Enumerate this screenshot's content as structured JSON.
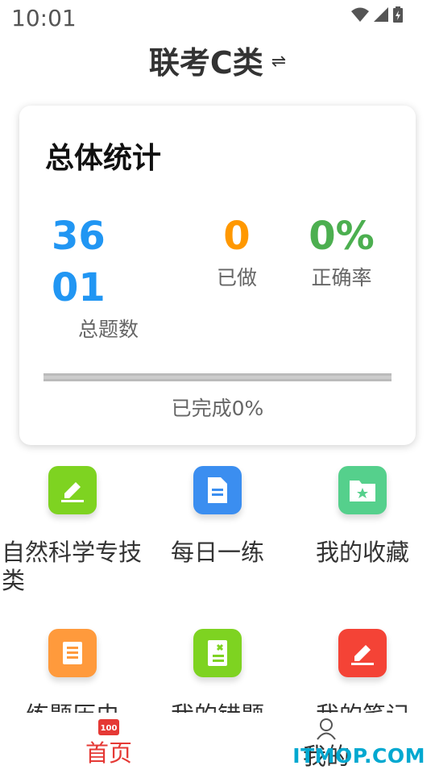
{
  "status_bar": {
    "time": "10:01"
  },
  "header": {
    "title": "联考C类",
    "switch_icon": "⇌"
  },
  "stats_card": {
    "title": "总体统计",
    "total": {
      "value": "3601",
      "label": "总题数"
    },
    "done": {
      "value": "0",
      "label": "已做"
    },
    "accuracy": {
      "value": "0%",
      "label": "正确率"
    },
    "progress_fraction": 0,
    "progress_text": "已完成0%"
  },
  "menu": [
    {
      "label": "自然科学专技类",
      "icon": "edit-icon",
      "color": "#7ed321"
    },
    {
      "label": "每日一练",
      "icon": "document-icon",
      "color": "#3b8ef0"
    },
    {
      "label": "我的收藏",
      "icon": "folder-star-icon",
      "color": "#55d08c"
    },
    {
      "label": "练题历史",
      "icon": "list-icon",
      "color": "#ff9a3c"
    },
    {
      "label": "我的错题",
      "icon": "wrong-book-icon",
      "color": "#7ed321"
    },
    {
      "label": "我的笔记",
      "icon": "note-pencil-icon",
      "color": "#f44336"
    }
  ],
  "bottom_nav": {
    "home": {
      "label": "首页",
      "badge": "100",
      "color": "#e53935"
    },
    "mine": {
      "label": "我的"
    }
  },
  "watermark": "ITMOP.COM"
}
